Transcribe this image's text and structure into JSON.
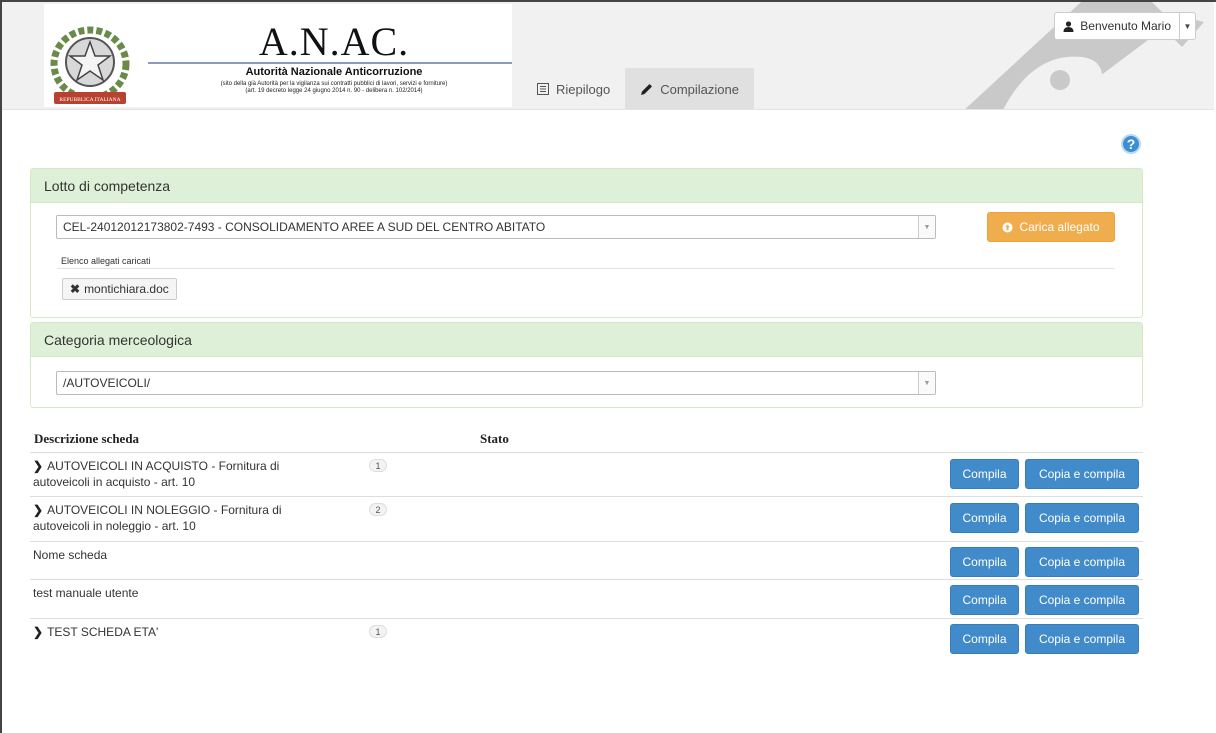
{
  "header": {
    "title": "A.N.AC.",
    "subtitle": "Autorità Nazionale Anticorruzione",
    "note_line1": "(sito della già Autorità per la vigilanza sui contratti pubblici di lavori, servizi e forniture)",
    "note_line2": "(art. 19 decreto legge 24 giugno 2014 n. 90 - delibera n. 102/2014)",
    "emblem_text": "REPUBBLICA ITALIANA"
  },
  "nav": {
    "tabs": [
      {
        "label": "Riepilogo",
        "icon": "list-icon",
        "active": false
      },
      {
        "label": "Compilazione",
        "icon": "pencil-icon",
        "active": true
      }
    ]
  },
  "user": {
    "label": "Benvenuto Mario",
    "icon": "user-icon"
  },
  "help": {
    "glyph": "?"
  },
  "lotto": {
    "heading": "Lotto di competenza",
    "selected": "CEL-24012012173802-7493 - CONSOLIDAMENTO AREE A SUD DEL CENTRO ABITATO",
    "upload_button": "Carica allegato",
    "attachments_label": "Elenco allegati caricati",
    "attachments": [
      "montichiara.doc"
    ]
  },
  "categoria": {
    "heading": "Categoria merceologica",
    "selected": "/AUTOVEICOLI/"
  },
  "table": {
    "headers": {
      "descrizione": "Descrizione scheda",
      "stato": "Stato"
    },
    "compila_label": "Compila",
    "copia_label": "Copia e compila",
    "rows": [
      {
        "line1": "AUTOVEICOLI IN ACQUISTO - Fornitura di",
        "line2": "autoveicoli in acquisto - art. 10",
        "badge": "1",
        "expandable": true
      },
      {
        "line1": "AUTOVEICOLI IN NOLEGGIO - Fornitura di",
        "line2": "autoveicoli in noleggio - art. 10",
        "badge": "2",
        "expandable": true
      },
      {
        "line1": "Nome scheda",
        "line2": "",
        "badge": "",
        "expandable": false
      },
      {
        "line1": "test manuale utente",
        "line2": "",
        "badge": "",
        "expandable": false
      },
      {
        "line1": "TEST SCHEDA ETA'",
        "line2": "",
        "badge": "1",
        "expandable": true
      }
    ]
  },
  "colors": {
    "primary": "#428bca",
    "warning": "#f0ad4e",
    "panel_heading": "#dff0d8"
  }
}
